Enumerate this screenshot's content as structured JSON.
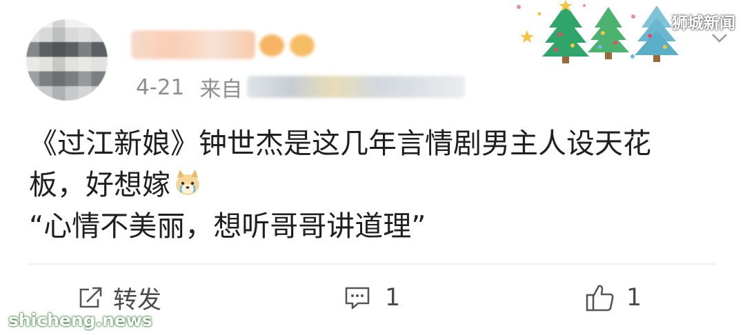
{
  "post": {
    "date": "4-21",
    "source_prefix": "来自",
    "text_lines": [
      "《过江新娘》钟世杰是这几年言情剧男主人设天花",
      "板，好想嫁",
      "“心情不美丽，想听哥哥讲道理”"
    ],
    "emoji": "crying-dog-emoji"
  },
  "actions": {
    "repost_label": "转发",
    "comment_count": "1",
    "like_count": "1"
  },
  "watermarks": {
    "top_right": "狮城新闻",
    "bottom_left": "shicheng.news"
  },
  "icons": {
    "repost": "share-icon",
    "comment": "comment-icon",
    "like": "thumbs-up-icon",
    "menu": "chevron-down-icon"
  },
  "colors": {
    "meta_text": "#8f8f8f",
    "body_text": "#1f1f1f",
    "action_text": "#4a4a4a",
    "divider": "#efefef"
  }
}
